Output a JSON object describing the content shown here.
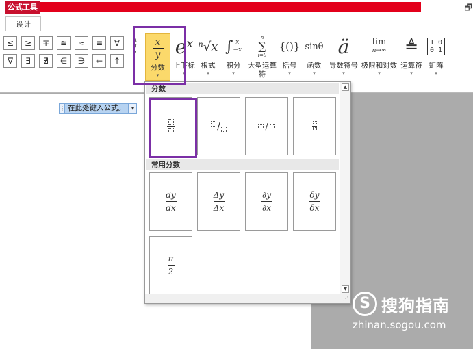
{
  "titlebar": {
    "context_tab": "公式工具",
    "minimize_glyph": "—",
    "restore_glyph": "🗗"
  },
  "ribbon_tabs": {
    "design": "设计"
  },
  "symbols": [
    "≤",
    "≥",
    "∓",
    "≅",
    "≈",
    "≡",
    "∀",
    "∇",
    "∃",
    "∄",
    "∈",
    "∋",
    "←",
    "↑"
  ],
  "tools": [
    {
      "id": "fraction",
      "label": "分数",
      "glyph_top": "x",
      "glyph_bottom": "y"
    },
    {
      "id": "script",
      "label": "上下标",
      "glyph": "eˣ"
    },
    {
      "id": "radical",
      "label": "根式",
      "glyph": "ⁿ√x"
    },
    {
      "id": "integral",
      "label": "积分",
      "glyph": "∫"
    },
    {
      "id": "large-operator",
      "label": "大型运算符",
      "glyph": "∑"
    },
    {
      "id": "bracket",
      "label": "括号",
      "glyph": "{()}"
    },
    {
      "id": "function",
      "label": "函数",
      "glyph": "sinθ"
    },
    {
      "id": "accent",
      "label": "导数符号",
      "glyph": "ä"
    },
    {
      "id": "limit-log",
      "label": "极限和对数",
      "glyph": "lim"
    },
    {
      "id": "operator",
      "label": "运算符",
      "glyph": "≜"
    },
    {
      "id": "matrix",
      "label": "矩阵",
      "glyph": "[1 0; 0 1]"
    }
  ],
  "integral_limits": {
    "upper": "x",
    "lower": "−x"
  },
  "sum_limits": {
    "upper": "n",
    "lower": "i=0"
  },
  "limit_sub": "n→∞",
  "document": {
    "placeholder": "在此处键入公式。"
  },
  "gallery": {
    "section_fractions": "分数",
    "section_common": "常用分数",
    "common": [
      {
        "id": "dy-dx",
        "num": "dy",
        "den": "dx"
      },
      {
        "id": "delta-y-delta-x",
        "num": "Δy",
        "den": "Δx"
      },
      {
        "id": "partial-y-partial-x",
        "num": "∂y",
        "den": "∂x"
      },
      {
        "id": "small-delta-y-x",
        "num": "δy",
        "den": "δx"
      },
      {
        "id": "pi-over-2",
        "num": "π",
        "den": "2"
      }
    ]
  },
  "watermark": {
    "logo": "S",
    "name": "搜狗指南",
    "url": "zhinan.sogou.com"
  },
  "colors": {
    "title_red": "#e3001b",
    "context_tab": "#c8102e",
    "fraction_active": "#fbd96b",
    "highlight_purple": "#7b2fa6"
  }
}
